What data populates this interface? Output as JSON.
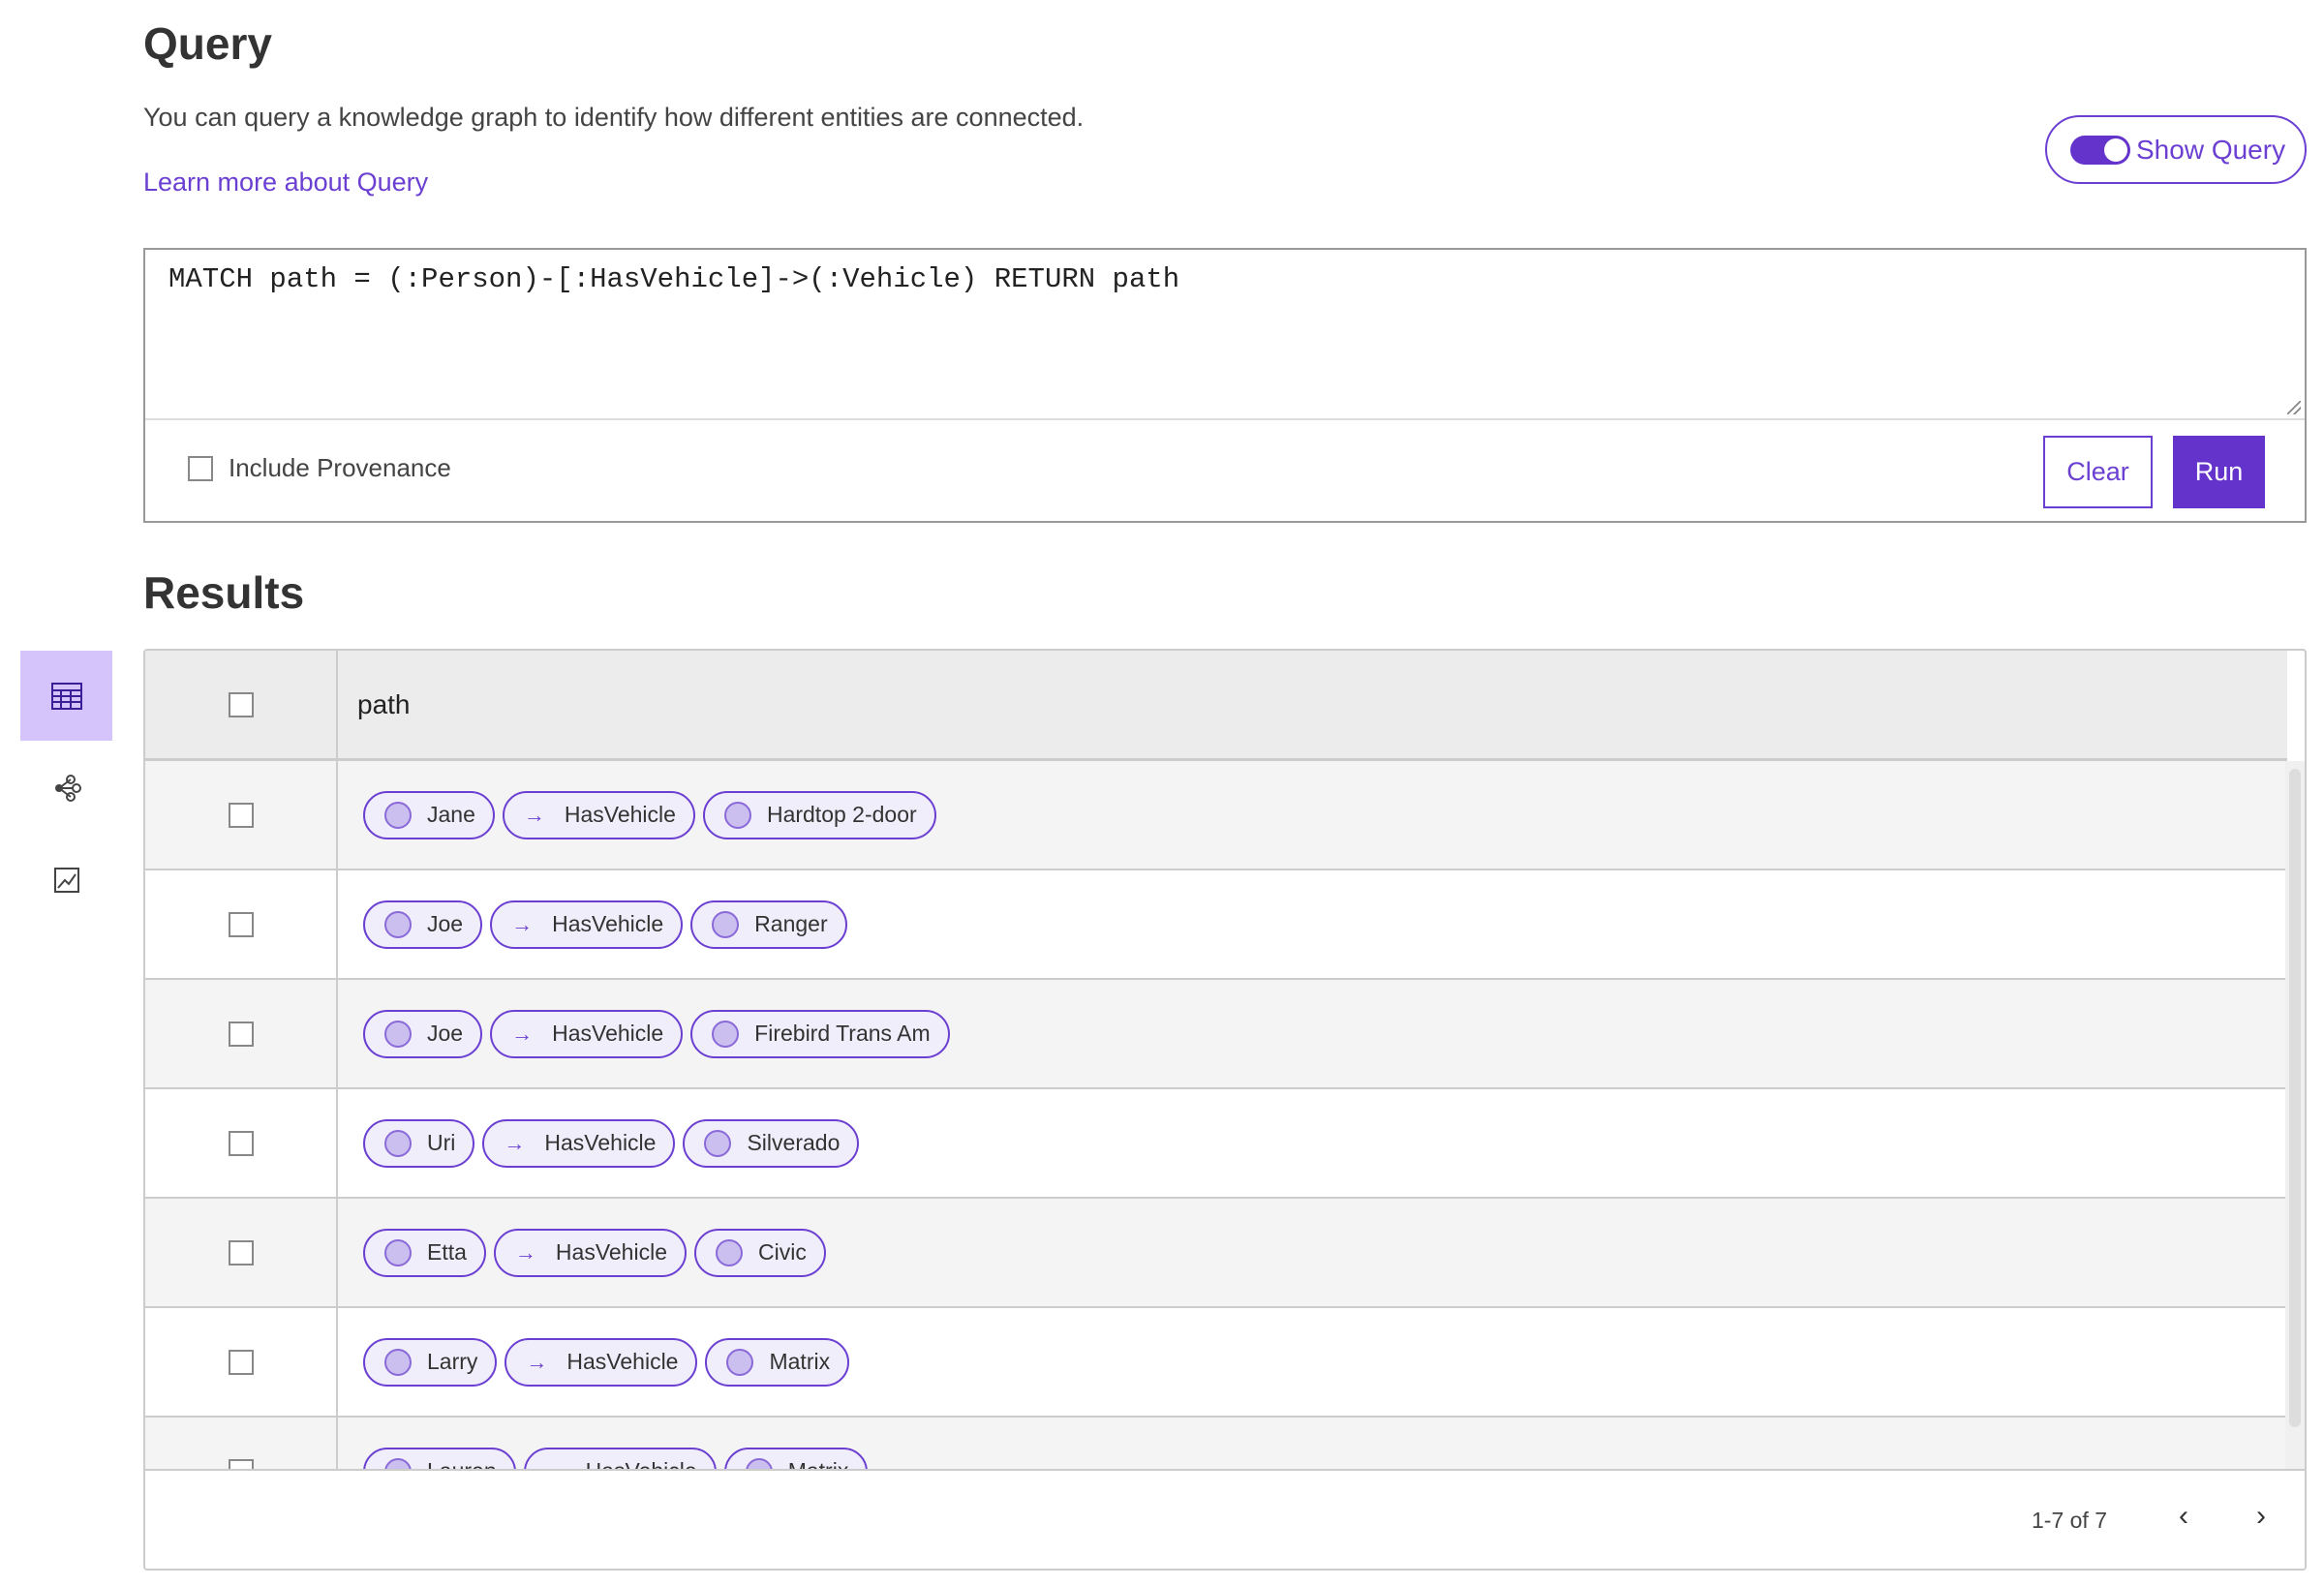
{
  "header": {
    "title": "Query",
    "description": "You can query a knowledge graph to identify how different entities are connected.",
    "learn_more": "Learn more about Query",
    "show_query_label": "Show Query",
    "show_query_on": true
  },
  "query": {
    "text": "MATCH path = (:Person)-[:HasVehicle]->(:Vehicle) RETURN path",
    "include_provenance_label": "Include Provenance",
    "include_provenance": false,
    "clear_label": "Clear",
    "run_label": "Run"
  },
  "results": {
    "title": "Results",
    "column": "path",
    "rows": [
      {
        "source": "Jane",
        "relation": "HasVehicle",
        "target": "Hardtop 2-door"
      },
      {
        "source": "Joe",
        "relation": "HasVehicle",
        "target": "Ranger"
      },
      {
        "source": "Joe",
        "relation": "HasVehicle",
        "target": "Firebird Trans Am"
      },
      {
        "source": "Uri",
        "relation": "HasVehicle",
        "target": "Silverado"
      },
      {
        "source": "Etta",
        "relation": "HasVehicle",
        "target": "Civic"
      },
      {
        "source": "Larry",
        "relation": "HasVehicle",
        "target": "Matrix"
      },
      {
        "source": "Lauren",
        "relation": "HasVehicle",
        "target": "Matrix"
      }
    ],
    "pagination": "1-7 of 7"
  },
  "sidebar": {
    "items": [
      {
        "icon": "table-icon",
        "active": true
      },
      {
        "icon": "graph-icon"
      },
      {
        "icon": "chart-icon"
      }
    ]
  },
  "colors": {
    "accent": "#6333cc",
    "chip_bg": "#f0eefa",
    "active_tab": "#d4c4fb"
  }
}
